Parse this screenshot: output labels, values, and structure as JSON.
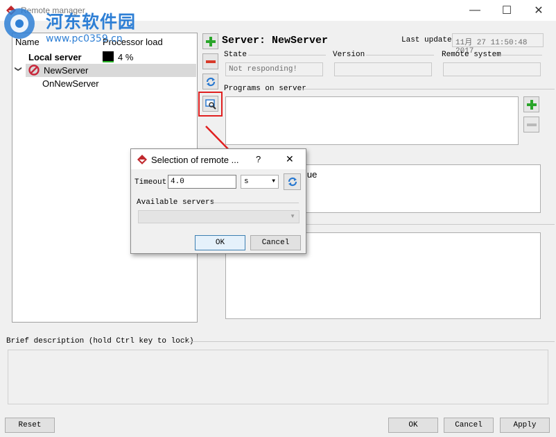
{
  "window": {
    "title": "Remote manager",
    "minimize": "—",
    "maximize": "☐",
    "close": "✕"
  },
  "watermark": {
    "line1": "河东软件园",
    "line2": "www.pc0359.cn"
  },
  "tree": {
    "col_name": "Name",
    "col_load": "Processor load",
    "local_label": "Local server",
    "local_load": "4 %",
    "server_name": "NewServer",
    "child_name": "OnNewServer",
    "expander": "❯"
  },
  "server": {
    "title": "Server: NewServer",
    "last_update_label": "Last update",
    "last_update_value": "11月 27 11:50:48 2017",
    "state_label": "State",
    "state_value": "Not responding!",
    "version_label": "Version",
    "version_value": "",
    "remote_system_label": "Remote system",
    "remote_system_value": "",
    "programs_label": "Programs on server",
    "partial_value_text": "lue"
  },
  "dialog": {
    "title": "Selection of remote ...",
    "help": "?",
    "close": "✕",
    "timeout_label": "Timeout",
    "timeout_value": "4.0",
    "unit_value": "s",
    "available_label": "Available servers",
    "ok": "OK",
    "cancel": "Cancel"
  },
  "description": {
    "label": "Brief description (hold Ctrl key to lock)"
  },
  "footer": {
    "reset": "Reset",
    "ok": "OK",
    "cancel": "Cancel",
    "apply": "Apply"
  },
  "colors": {
    "accent_red": "#e02020",
    "plus_green": "#2aa52a",
    "minus_red": "#d83a2a",
    "refresh_blue": "#2878d0"
  }
}
